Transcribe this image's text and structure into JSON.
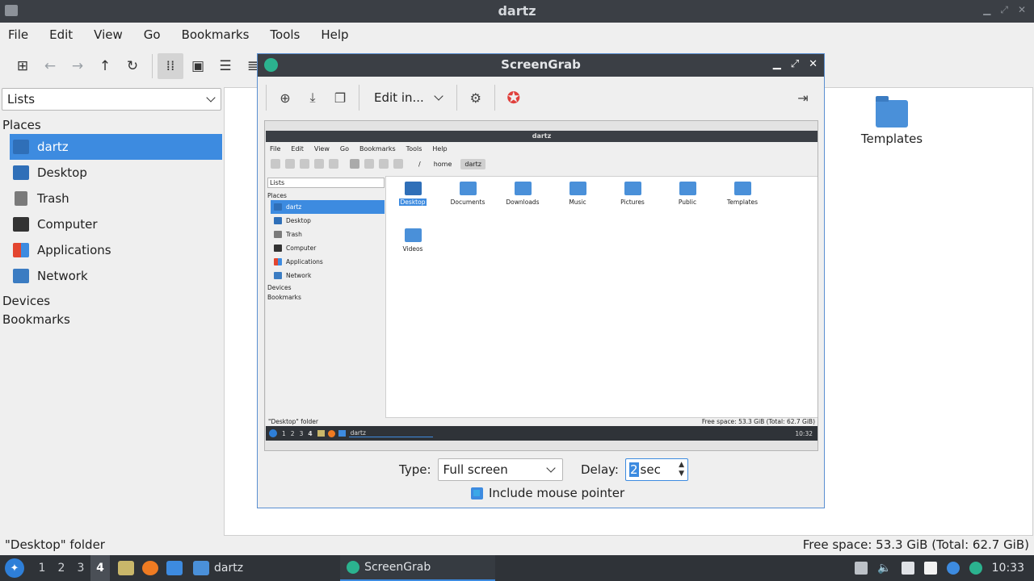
{
  "fm": {
    "title": "dartz",
    "menu": [
      "File",
      "Edit",
      "View",
      "Go",
      "Bookmarks",
      "Tools",
      "Help"
    ],
    "sidebar_select": "Lists",
    "sections": {
      "places": "Places",
      "devices": "Devices",
      "bookmarks": "Bookmarks"
    },
    "places": [
      "dartz",
      "Desktop",
      "Trash",
      "Computer",
      "Applications",
      "Network"
    ],
    "visible_folder": "Templates",
    "status_left": "\"Desktop\" folder",
    "status_right": "Free space: 53.3 GiB (Total: 62.7 GiB)"
  },
  "taskbar": {
    "workspaces": [
      "1",
      "2",
      "3",
      "4"
    ],
    "current_workspace": "4",
    "tasks": [
      "dartz",
      "ScreenGrab"
    ],
    "clock": "10:33"
  },
  "screengrab": {
    "title": "ScreenGrab",
    "edit_label": "Edit in...",
    "type_label": "Type:",
    "type_value": "Full screen",
    "delay_label": "Delay:",
    "delay_value": "2",
    "delay_unit": "sec",
    "pointer_label": "Include mouse pointer",
    "pointer_checked": true
  },
  "preview": {
    "title": "dartz",
    "menu": [
      "File",
      "Edit",
      "View",
      "Go",
      "Bookmarks",
      "Tools",
      "Help"
    ],
    "breadcrumbs": [
      "/",
      "home",
      "dartz"
    ],
    "sidebar_select": "Lists",
    "places_head": "Places",
    "places": [
      "dartz",
      "Desktop",
      "Trash",
      "Computer",
      "Applications",
      "Network"
    ],
    "devices_head": "Devices",
    "bookmarks_head": "Bookmarks",
    "folders": [
      "Desktop",
      "Documents",
      "Downloads",
      "Music",
      "Pictures",
      "Public",
      "Templates",
      "Videos"
    ],
    "status_left": "\"Desktop\" folder",
    "status_right": "Free space: 53.3 GiB (Total: 62.7 GiB)",
    "workspaces": [
      "1",
      "2",
      "3",
      "4"
    ],
    "task": "dartz",
    "clock": "10:32"
  }
}
